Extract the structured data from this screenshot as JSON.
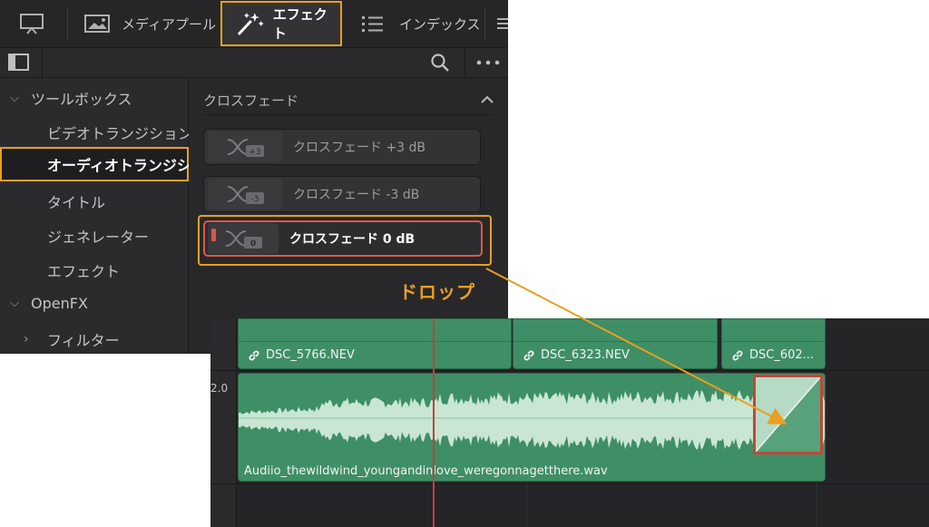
{
  "tabs": {
    "media_pool": "メディアプール",
    "effects": "エフェクト",
    "index": "インデックス"
  },
  "sidebar": {
    "toolbox": "ツールボックス",
    "video_transition": "ビデオトランジション",
    "audio_transition": "オーディオトランジシ...",
    "titles": "タイトル",
    "generators": "ジェネレーター",
    "effects": "エフェクト",
    "openfx": "OpenFX",
    "filters": "フィルター"
  },
  "content": {
    "section_title": "クロスフェード",
    "items": [
      {
        "label": "クロスフェード +3 dB",
        "badge": "+3"
      },
      {
        "label": "クロスフェード -3 dB",
        "badge": "-3"
      },
      {
        "label": "クロスフェード 0 dB",
        "badge": "0"
      }
    ]
  },
  "annotation": {
    "drop": "ドロップ"
  },
  "timeline": {
    "video_clips": [
      "DSC_5766.NEV",
      "DSC_6323.NEV",
      "DSC_602..."
    ],
    "audio_clip": "Audiio_thewildwind_youngandinlove_weregonnagetthere.wav",
    "track_level": "2.0"
  },
  "colors": {
    "accent": "#e8a020",
    "clip_green": "#3f8f66",
    "playhead": "#c04040",
    "selection_red": "#d85a4a"
  }
}
